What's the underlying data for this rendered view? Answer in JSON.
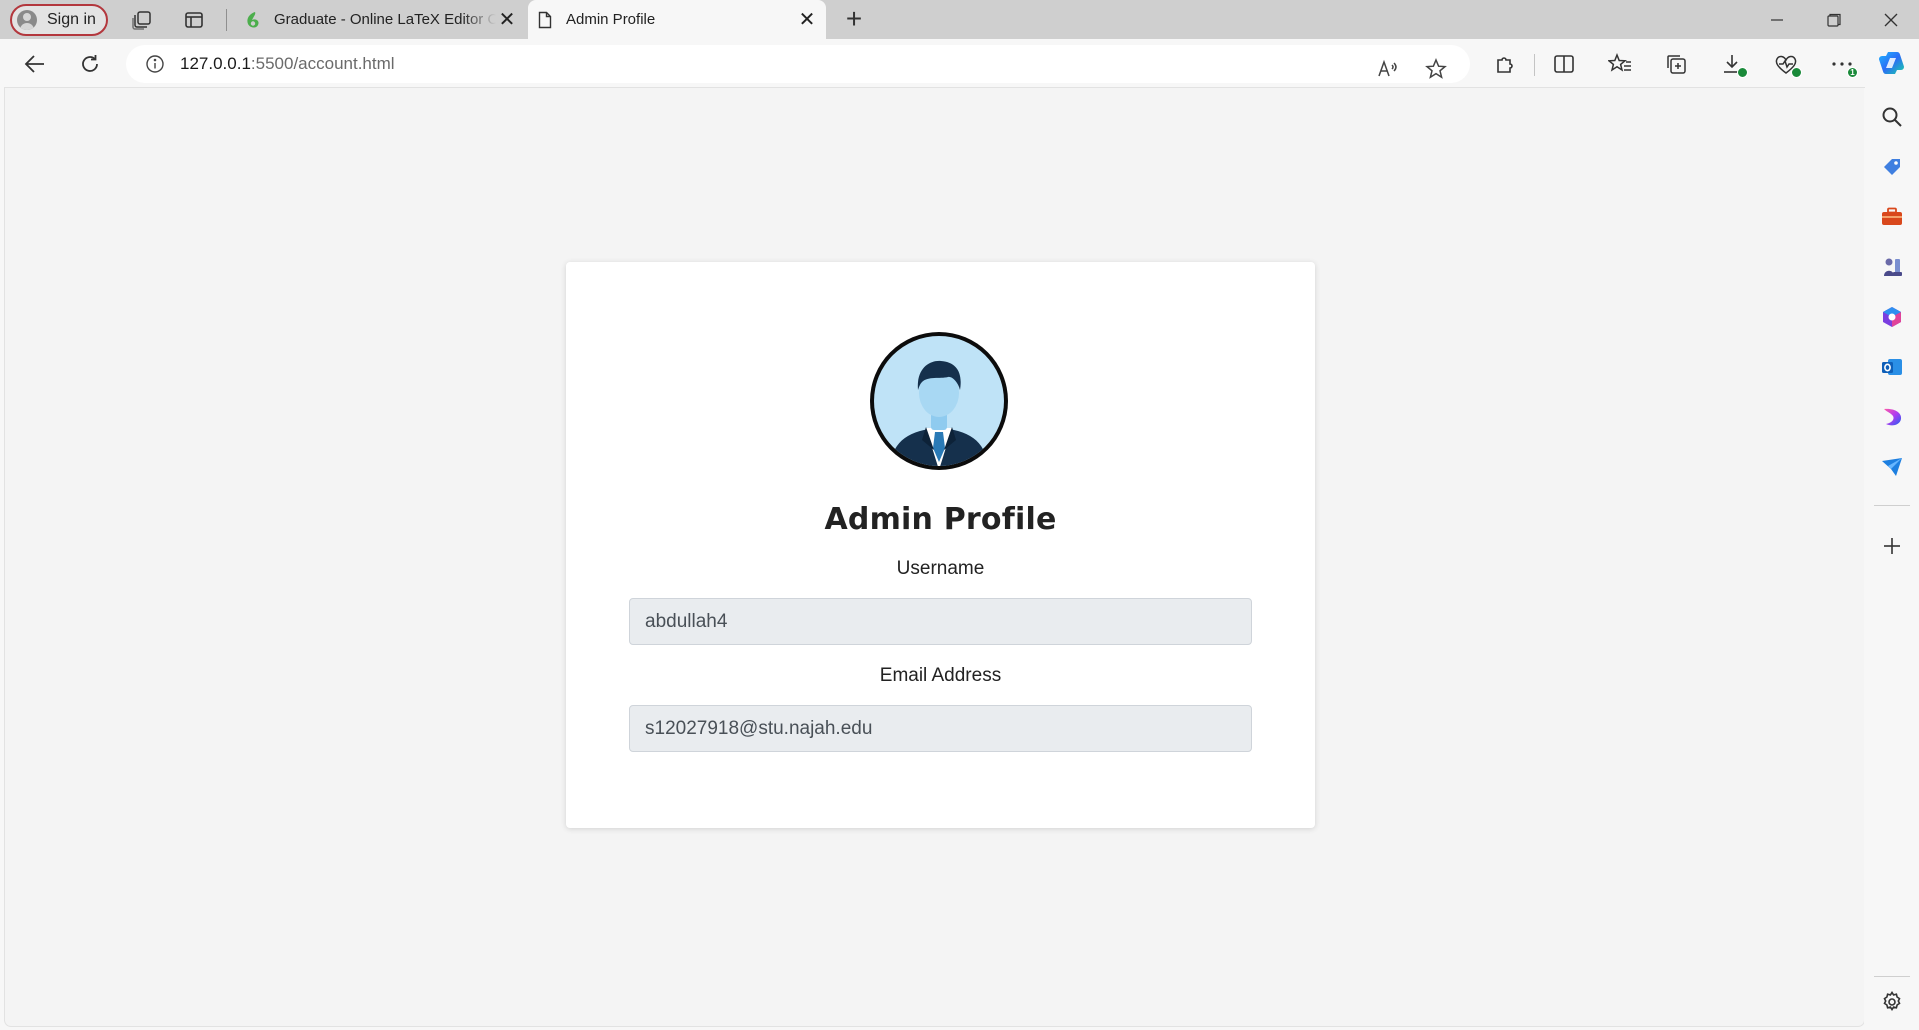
{
  "browser": {
    "signin_label": "Sign in",
    "tabs": [
      {
        "title": "Graduate - Online LaTeX Editor Overleaf",
        "active": false
      },
      {
        "title": "Admin Profile",
        "active": true
      }
    ],
    "url_host": "127.0.0.1",
    "url_rest": ":5500/account.html",
    "download_badge": "",
    "more_badge": "1"
  },
  "page": {
    "title": "Admin Profile",
    "username_label": "Username",
    "username_value": "abdullah4",
    "email_label": "Email Address",
    "email_value": "s12027918@stu.najah.edu"
  },
  "colors": {
    "accent_signin_border": "#b3373d",
    "overleaf_green": "#4cae4c",
    "input_bg": "#e9ecef"
  }
}
